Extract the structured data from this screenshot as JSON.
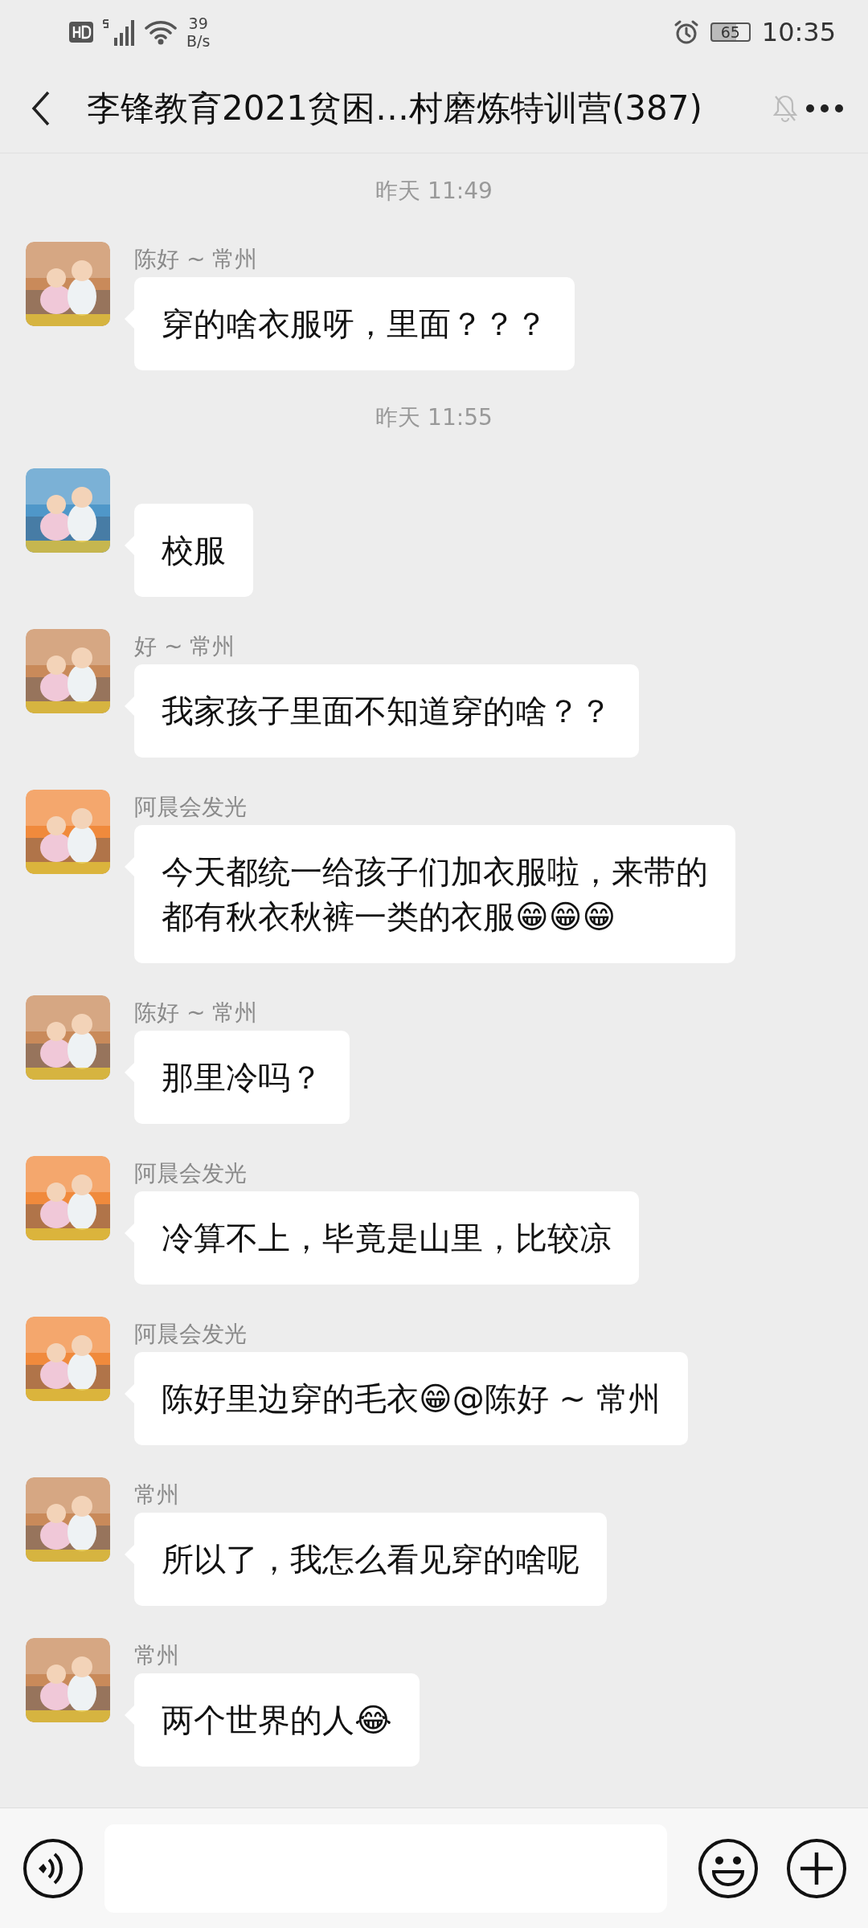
{
  "status_bar": {
    "network_speed": "39",
    "speed_unit": "B/s",
    "battery": "65",
    "time": "10:35"
  },
  "header": {
    "title": "李锋教育2021贫困…村磨炼特训营(387)",
    "muted": true
  },
  "messages": [
    {
      "kind": "time",
      "text": "昨天 11:49"
    },
    {
      "kind": "message",
      "name": "陈好 ~ 常州",
      "text": "穿的啥衣服呀，里面？？？"
    },
    {
      "kind": "time",
      "text": "昨天 11:55"
    },
    {
      "kind": "message",
      "text": "校服"
    },
    {
      "kind": "message",
      "name": "好 ~ 常州",
      "text": "我家孩子里面不知道穿的啥？？"
    },
    {
      "kind": "message",
      "name": "阿晨会发光",
      "text": "今天都统一给孩子们加衣服啦，来带的都有秋衣秋裤一类的衣服😁😁😁"
    },
    {
      "kind": "message",
      "name": "陈好 ~ 常州",
      "text": "那里冷吗？"
    },
    {
      "kind": "message",
      "name": "阿晨会发光",
      "text": "冷算不上，毕竟是山里，比较凉"
    },
    {
      "kind": "message",
      "name": "阿晨会发光",
      "text": "陈好里边穿的毛衣😁@陈好 ~ 常州"
    },
    {
      "kind": "message",
      "name": "常州",
      "text": "所以了，我怎么看见穿的啥呢"
    },
    {
      "kind": "message",
      "name": "常州",
      "text": "两个世界的人😂"
    }
  ]
}
